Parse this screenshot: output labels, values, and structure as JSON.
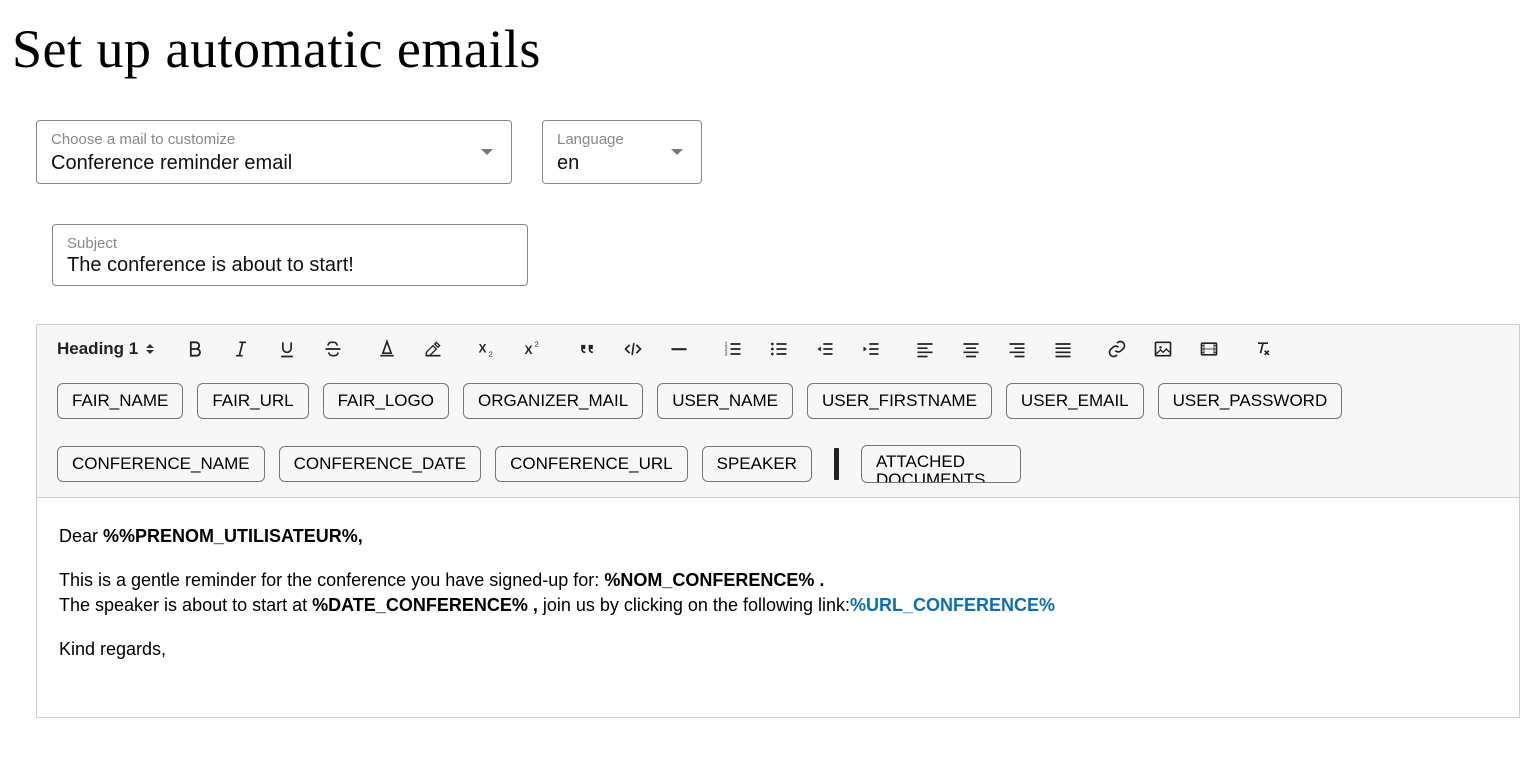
{
  "page": {
    "title": "Set up automatic emails"
  },
  "form": {
    "mailSelect": {
      "label": "Choose a mail to customize",
      "value": "Conference reminder email"
    },
    "languageSelect": {
      "label": "Language",
      "value": "en"
    },
    "subject": {
      "label": "Subject",
      "value": "The conference is about to start!"
    }
  },
  "toolbar": {
    "heading": "Heading 1",
    "icons": {
      "bold": "bold-icon",
      "italic": "italic-icon",
      "underline": "underline-icon",
      "strike": "strikethrough-icon",
      "fontcolor": "font-color-icon",
      "highlight": "highlight-icon",
      "subscript": "subscript-icon",
      "superscript": "superscript-icon",
      "quote": "blockquote-icon",
      "code": "code-icon",
      "hr": "horizontal-rule-icon",
      "ol": "ordered-list-icon",
      "ul": "unordered-list-icon",
      "outdent": "outdent-icon",
      "indent": "indent-icon",
      "alignleft": "align-left-icon",
      "aligncenter": "align-center-icon",
      "alignright": "align-right-icon",
      "alignjustify": "align-justify-icon",
      "link": "link-icon",
      "image": "image-icon",
      "video": "video-icon",
      "clear": "clear-format-icon"
    }
  },
  "tokens": {
    "row1": [
      "FAIR_NAME",
      "FAIR_URL",
      "FAIR_LOGO",
      "ORGANIZER_MAIL",
      "USER_NAME",
      "USER_FIRSTNAME",
      "USER_EMAIL",
      "USER_PASSWORD"
    ],
    "row2": [
      "CONFERENCE_NAME",
      "CONFERENCE_DATE",
      "CONFERENCE_URL",
      "SPEAKER"
    ],
    "attached_top": "ATTACHED",
    "attached_bottom": "DOCUMENTS"
  },
  "body": {
    "dear_prefix": "Dear ",
    "dear_token": "%%PRENOM_UTILISATEUR%,",
    "line2a": "This is a gentle reminder for the conference you have signed-up for: ",
    "line2b": "%NOM_CONFERENCE% .",
    "line3a": "The speaker is about to start at ",
    "line3b": "%DATE_CONFERENCE% ,",
    "line3c": " join us by clicking on the following link:",
    "line3d": "%URL_CONFERENCE%",
    "closing": "Kind regards,"
  }
}
